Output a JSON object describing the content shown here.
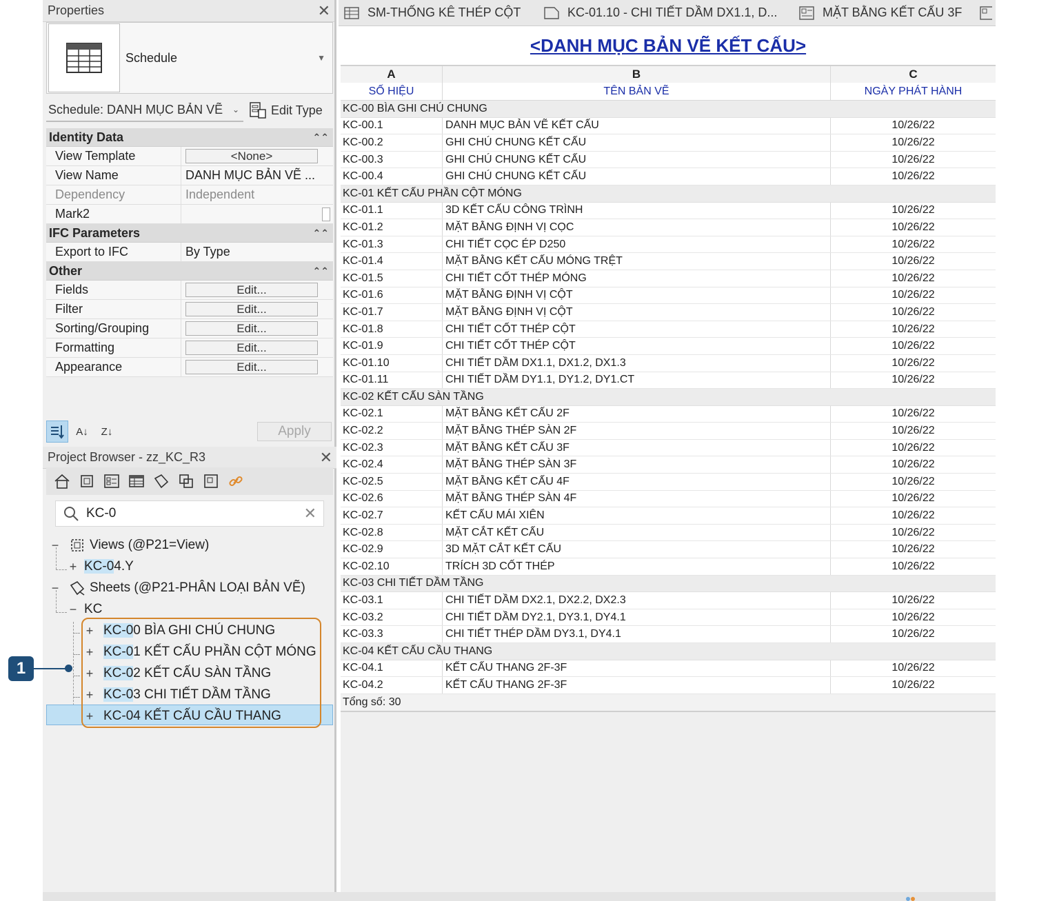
{
  "properties": {
    "title": "Properties",
    "type_name": "Schedule",
    "instance_filter": "Schedule: DANH MỤC BẢN VẼ K",
    "edit_type": "Edit Type",
    "groups": {
      "identity": "Identity Data",
      "ifc": "IFC Parameters",
      "other": "Other"
    },
    "identity_rows": [
      {
        "key": "View Template",
        "value": "<None>"
      },
      {
        "key": "View Name",
        "value": "DANH MỤC BẢN VẼ ..."
      },
      {
        "key": "Dependency",
        "value": "Independent"
      },
      {
        "key": "Mark2",
        "value": ""
      }
    ],
    "ifc_rows": [
      {
        "key": "Export to IFC",
        "value": "By Type"
      }
    ],
    "other_rows": [
      {
        "key": "Fields",
        "value": "Edit..."
      },
      {
        "key": "Filter",
        "value": "Edit..."
      },
      {
        "key": "Sorting/Grouping",
        "value": "Edit..."
      },
      {
        "key": "Formatting",
        "value": "Edit..."
      },
      {
        "key": "Appearance",
        "value": "Edit..."
      }
    ],
    "apply": "Apply"
  },
  "browser": {
    "title": "Project Browser - zz_KC_R3",
    "search_value": "KC-0",
    "views_node": "Views (@P21=View)",
    "views_child": {
      "hl": "KC-0",
      "rest": "4.Y"
    },
    "sheets_node": "Sheets (@P21-PHÂN LOẠI BẢN VẼ)",
    "kc_node": "KC",
    "sheet_items": [
      {
        "hl": "KC-0",
        "rest": "0 BÌA GHI CHÚ CHUNG"
      },
      {
        "hl": "KC-0",
        "rest": "1 KẾT CẤU PHẦN CỘT MÓNG"
      },
      {
        "hl": "KC-0",
        "rest": "2 KẾT CẤU SÀN TẦNG"
      },
      {
        "hl": "KC-0",
        "rest": "3 CHI TIẾT DẦM TẦNG"
      },
      {
        "hl": "",
        "rest": "KC-04 KẾT CẤU CẦU THANG"
      }
    ]
  },
  "callout": {
    "number": "1"
  },
  "tabs": [
    {
      "label": "SM-THỐNG KÊ THÉP CỘT"
    },
    {
      "label": "KC-01.10 - CHI TIẾT DẦM DX1.1, D..."
    },
    {
      "label": "MẶT BẰNG KẾT CẤU 3F"
    }
  ],
  "schedule": {
    "title": "<DANH MỤC BẢN VẼ KẾT CẤU>",
    "col_letters": [
      "A",
      "B",
      "C"
    ],
    "col_labels": [
      "SỐ HIỆU",
      "TÊN BẢN VẼ",
      "NGÀY PHÁT HÀNH"
    ],
    "groups": [
      {
        "header": "KC-00 BÌA GHI CHÚ CHUNG",
        "rows": [
          [
            "KC-00.1",
            "DANH MỤC BẢN VẼ KẾT CẤU",
            "10/26/22"
          ],
          [
            "KC-00.2",
            "GHI CHÚ CHUNG KẾT CẤU",
            "10/26/22"
          ],
          [
            "KC-00.3",
            "GHI CHÚ CHUNG KẾT CẤU",
            "10/26/22"
          ],
          [
            "KC-00.4",
            "GHI CHÚ CHUNG KẾT CẤU",
            "10/26/22"
          ]
        ]
      },
      {
        "header": "KC-01 KẾT CẤU PHẦN CỘT MÓNG",
        "rows": [
          [
            "KC-01.1",
            "3D KẾT CẤU CÔNG TRÌNH",
            "10/26/22"
          ],
          [
            "KC-01.2",
            "MẶT BẰNG ĐỊNH VỊ CỌC",
            "10/26/22"
          ],
          [
            "KC-01.3",
            "CHI TIẾT CỌC ÉP D250",
            "10/26/22"
          ],
          [
            "KC-01.4",
            "MẶT BẰNG KẾT CẤU MÓNG TRỆT",
            "10/26/22"
          ],
          [
            "KC-01.5",
            "CHI TIẾT CỐT THÉP MÓNG",
            "10/26/22"
          ],
          [
            "KC-01.6",
            "MẶT BẰNG ĐỊNH VỊ CỘT",
            "10/26/22"
          ],
          [
            "KC-01.7",
            "MẶT BẰNG ĐỊNH VỊ CỘT",
            "10/26/22"
          ],
          [
            "KC-01.8",
            "CHI TIẾT CỐT THÉP CỘT",
            "10/26/22"
          ],
          [
            "KC-01.9",
            "CHI TIẾT CỐT THÉP CỘT",
            "10/26/22"
          ],
          [
            "KC-01.10",
            "CHI TIẾT DẦM DX1.1, DX1.2, DX1.3",
            "10/26/22"
          ],
          [
            "KC-01.11",
            "CHI TIẾT DẦM DY1.1, DY1.2, DY1.CT",
            "10/26/22"
          ]
        ]
      },
      {
        "header": "KC-02 KẾT CẤU SÀN TẦNG",
        "rows": [
          [
            "KC-02.1",
            "MẶT BẰNG KẾT CẤU 2F",
            "10/26/22"
          ],
          [
            "KC-02.2",
            "MẶT BẰNG THÉP SÀN 2F",
            "10/26/22"
          ],
          [
            "KC-02.3",
            "MẶT BẰNG KẾT CẤU 3F",
            "10/26/22"
          ],
          [
            "KC-02.4",
            "MẶT BẰNG THÉP SÀN 3F",
            "10/26/22"
          ],
          [
            "KC-02.5",
            "MẶT BẰNG KẾT CẤU 4F",
            "10/26/22"
          ],
          [
            "KC-02.6",
            "MẶT BẰNG THÉP SÀN 4F",
            "10/26/22"
          ],
          [
            "KC-02.7",
            "KẾT CẤU MÁI XIÊN",
            "10/26/22"
          ],
          [
            "KC-02.8",
            "MẶT CẮT KẾT CẤU",
            "10/26/22"
          ],
          [
            "KC-02.9",
            "3D MẶT CẮT KẾT CẤU",
            "10/26/22"
          ],
          [
            "KC-02.10",
            "TRÍCH 3D CỐT THÉP",
            "10/26/22"
          ]
        ]
      },
      {
        "header": "KC-03 CHI TIẾT DẦM TẦNG",
        "rows": [
          [
            "KC-03.1",
            "CHI TIẾT DẦM DX2.1, DX2.2, DX2.3",
            "10/26/22"
          ],
          [
            "KC-03.2",
            "CHI TIẾT DẦM DY2.1, DY3.1, DY4.1",
            "10/26/22"
          ],
          [
            "KC-03.3",
            "CHI TIẾT THÉP DẦM DY3.1, DY4.1",
            "10/26/22"
          ]
        ]
      },
      {
        "header": "KC-04 KẾT CẤU CẦU THANG",
        "rows": [
          [
            "KC-04.1",
            "KẾT CẤU THANG 2F-3F",
            "10/26/22"
          ],
          [
            "KC-04.2",
            "KẾT CẤU THANG 2F-3F",
            "10/26/22"
          ]
        ]
      }
    ],
    "total": "Tổng số: 30"
  },
  "colors": {
    "accent_blue": "#1a2ea8",
    "callout_orange": "#d4862c",
    "marker_navy": "#1f4e79",
    "selection": "#bfe0f4"
  }
}
